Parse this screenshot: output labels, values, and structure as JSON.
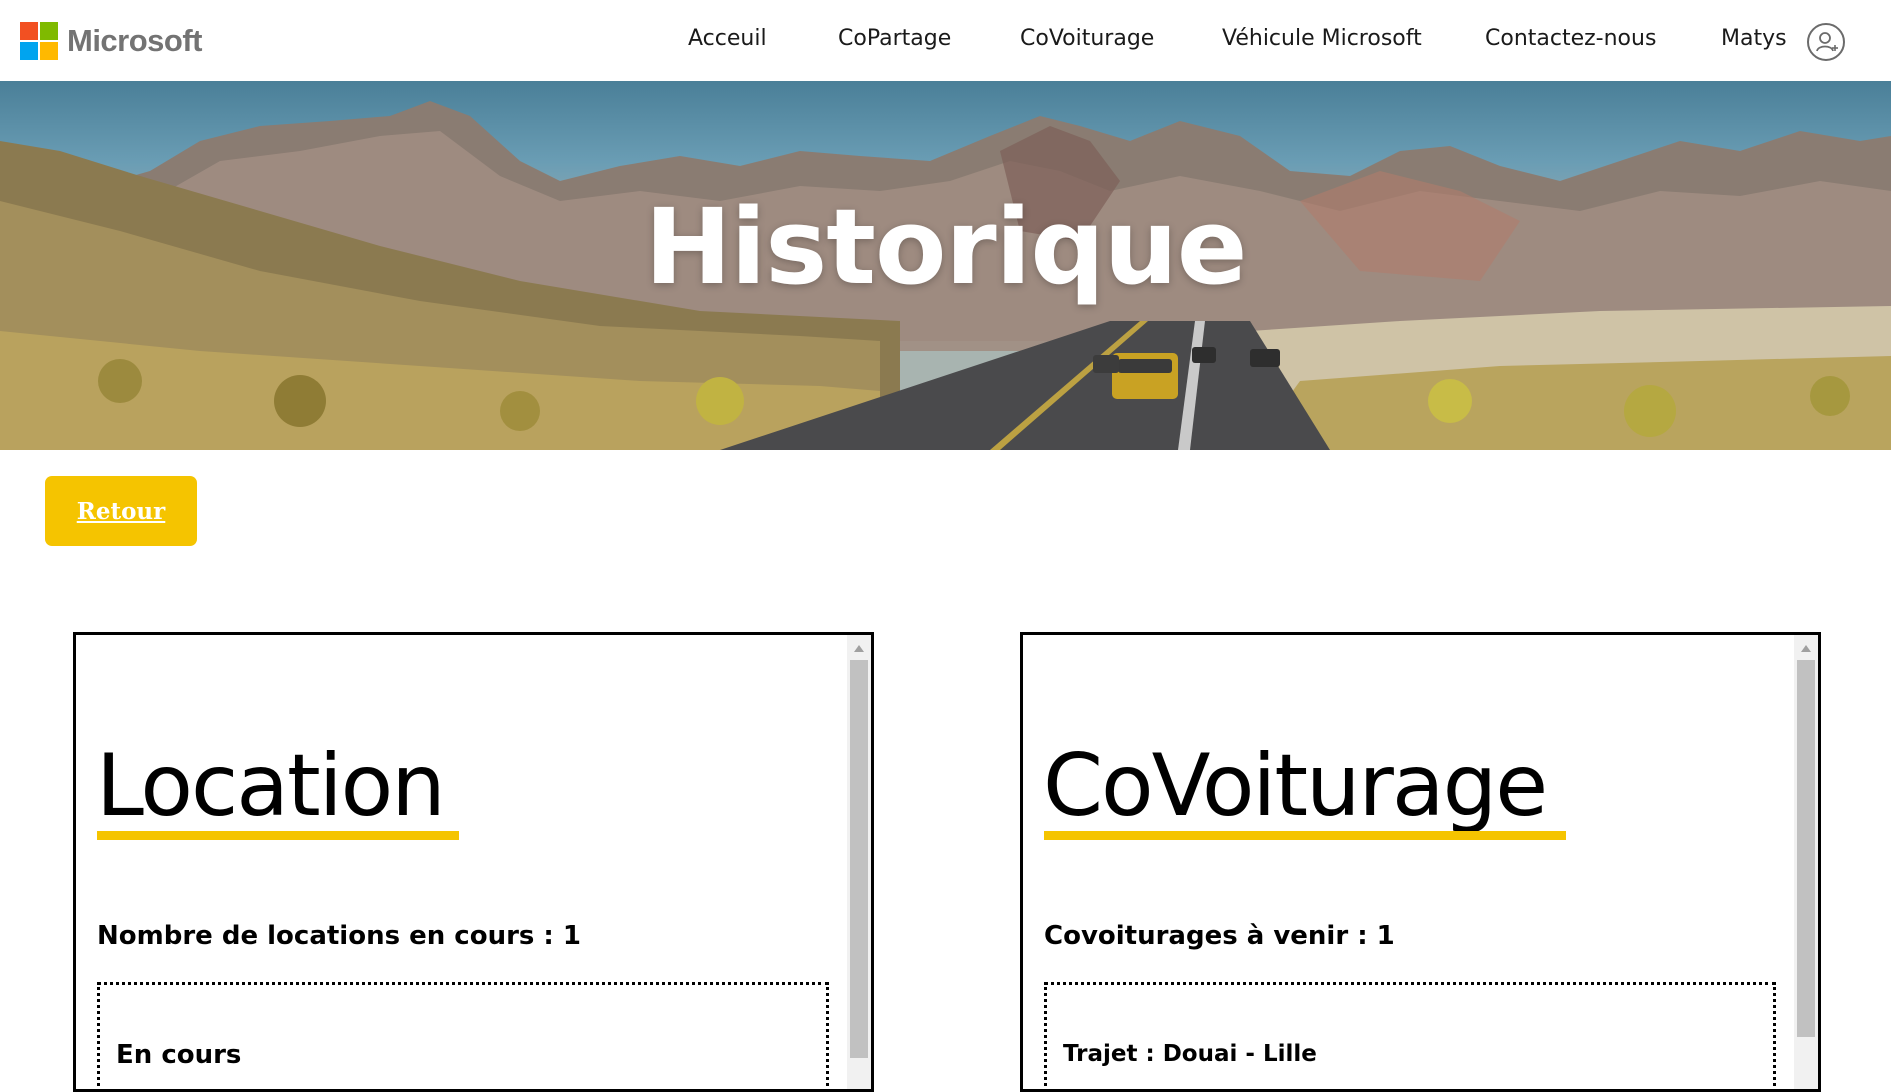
{
  "header": {
    "brand": "Microsoft",
    "logo_colors": [
      "#f25022",
      "#7fba00",
      "#00a4ef",
      "#ffb900"
    ],
    "nav": [
      {
        "label": "Acceuil"
      },
      {
        "label": "CoPartage"
      },
      {
        "label": "CoVoiturage"
      },
      {
        "label": "Véhicule Microsoft"
      },
      {
        "label": "Contactez-nous"
      },
      {
        "label": "Matys"
      }
    ],
    "user_icon": "user-add-icon"
  },
  "hero": {
    "title": "Historique"
  },
  "back_button": {
    "label": "Retour"
  },
  "panels": {
    "location": {
      "title": "Location",
      "count_text": "Nombre de locations en cours : 1",
      "card_heading": "En cours"
    },
    "covoiturage": {
      "title": "CoVoiturage",
      "count_text": "Covoiturages à venir : 1",
      "card_trajet": "Trajet : Douai - Lille"
    }
  },
  "colors": {
    "accent": "#f5c400",
    "text": "#000000",
    "nav_text": "#1a1a1a"
  }
}
